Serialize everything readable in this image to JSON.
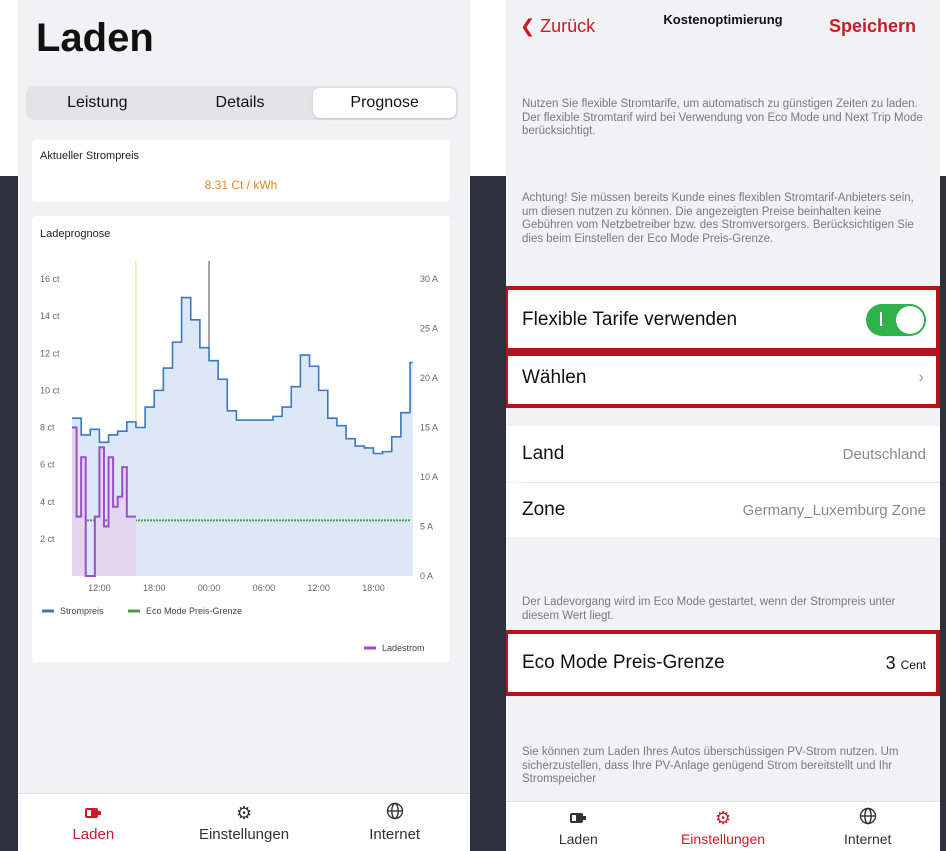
{
  "left": {
    "title": "Laden",
    "segments": [
      "Leistung",
      "Details",
      "Prognose"
    ],
    "active_segment": "Prognose",
    "price_card": {
      "label": "Aktueller Strompreis",
      "value": "8.31 Ct / kWh"
    },
    "chart_card": {
      "label": "Ladeprognose"
    },
    "tabs": [
      {
        "label": "Laden",
        "icon": "battery-icon",
        "active": true
      },
      {
        "label": "Einstellungen",
        "icon": "gear-icon",
        "active": false
      },
      {
        "label": "Internet",
        "icon": "globe-icon",
        "active": false
      }
    ]
  },
  "chart_data": {
    "type": "line",
    "title": "Ladeprognose",
    "x_ticks": [
      "12:00",
      "18:00",
      "00:00",
      "06:00",
      "12:00",
      "18:00"
    ],
    "y_left_ticks": [
      "2 ct",
      "4 ct",
      "6 ct",
      "8 ct",
      "10 ct",
      "12 ct",
      "14 ct",
      "16 ct"
    ],
    "y_left_range": [
      0,
      16
    ],
    "y_right_ticks": [
      "0 A",
      "5 A",
      "10 A",
      "15 A",
      "20 A",
      "25 A",
      "30 A"
    ],
    "y_right_range": [
      0,
      30
    ],
    "legend": [
      "Strompreis",
      "Eco Mode Preis-Grenze",
      "Ladestrom"
    ],
    "colors": {
      "strompreis": "#3a78c6",
      "eco": "#4c9a4c",
      "ladestrom": "#9b4fc9"
    },
    "series": [
      {
        "name": "Strompreis",
        "axis": "left",
        "x": [
          9,
          10,
          11,
          12,
          13,
          14,
          15,
          16,
          17,
          18,
          19,
          20,
          21,
          22,
          23,
          24,
          25,
          26,
          27,
          28,
          29,
          30,
          31,
          32,
          33,
          34,
          35,
          36,
          37,
          38,
          39,
          40,
          41,
          42,
          43,
          44,
          45,
          46
        ],
        "y": [
          8.5,
          7.6,
          7.9,
          7.2,
          7.6,
          7.8,
          8.3,
          8.0,
          9.1,
          10.0,
          11.2,
          12.6,
          15.0,
          13.8,
          12.3,
          11.6,
          10.6,
          8.9,
          8.4,
          8.4,
          8.4,
          8.4,
          8.6,
          9.1,
          10.2,
          11.9,
          11.3,
          10.0,
          8.5,
          8.1,
          7.4,
          7.0,
          6.9,
          6.6,
          6.7,
          7.5,
          8.8,
          11.5
        ]
      },
      {
        "name": "Eco Mode Preis-Grenze",
        "axis": "left",
        "x": [
          9,
          46
        ],
        "y": [
          3,
          3
        ]
      },
      {
        "name": "Ladestrom",
        "axis": "right",
        "x": [
          9,
          9.5,
          10,
          10.5,
          11,
          11.5,
          12,
          12.5,
          13,
          13.5,
          14,
          14.5,
          15,
          16
        ],
        "y": [
          15,
          6,
          12,
          0,
          0,
          6,
          13,
          5,
          12,
          7,
          8,
          11,
          6,
          6
        ]
      }
    ],
    "x_range": [
      9,
      46
    ],
    "grid": false,
    "legend_placement": "bottom"
  },
  "right": {
    "nav": {
      "back": "Zurück",
      "title": "Kostenoptimierung",
      "save": "Speichern"
    },
    "para1": "Nutzen Sie flexible Stromtarife, um automatisch zu günstigen Zeiten zu laden. Der flexible Stromtarif wird bei Verwendung von Eco Mode und Next Trip Mode berücksichtigt.",
    "para2": "Achtung! Sie müssen bereits Kunde eines flexiblen Stromtarif-Anbieters sein, um diesen nutzen zu können. Die angezeigten Preise beinhalten keine Gebühren vom Netzbetreiber bzw. des Stromversorgers. Berücksichtigen Sie dies beim Einstellen der Eco Mode Preis-Grenze.",
    "flex_label": "Flexible Tarife verwenden",
    "flex_on": true,
    "choose_label": "Wählen",
    "land_label": "Land",
    "land_value": "Deutschland",
    "zone_label": "Zone",
    "zone_value": "Germany_Luxemburg Zone",
    "para3": "Der Ladevorgang wird im Eco Mode gestartet, wenn der Strompreis unter diesem Wert liegt.",
    "eco_label": "Eco Mode Preis-Grenze",
    "eco_value": "3",
    "eco_unit": "Cent",
    "para4": "Sie können zum Laden Ihres Autos überschüssigen PV-Strom nutzen. Um sicherzustellen, dass Ihre PV-Anlage genügend Strom bereitstellt und Ihr Stromspeicher",
    "highlight_color": "#b5121b",
    "accent_color": "#cc1a2a",
    "tabs": [
      {
        "label": "Laden",
        "icon": "battery-icon",
        "active": false
      },
      {
        "label": "Einstellungen",
        "icon": "gear-icon",
        "active": true
      },
      {
        "label": "Internet",
        "icon": "globe-icon",
        "active": false
      }
    ]
  }
}
